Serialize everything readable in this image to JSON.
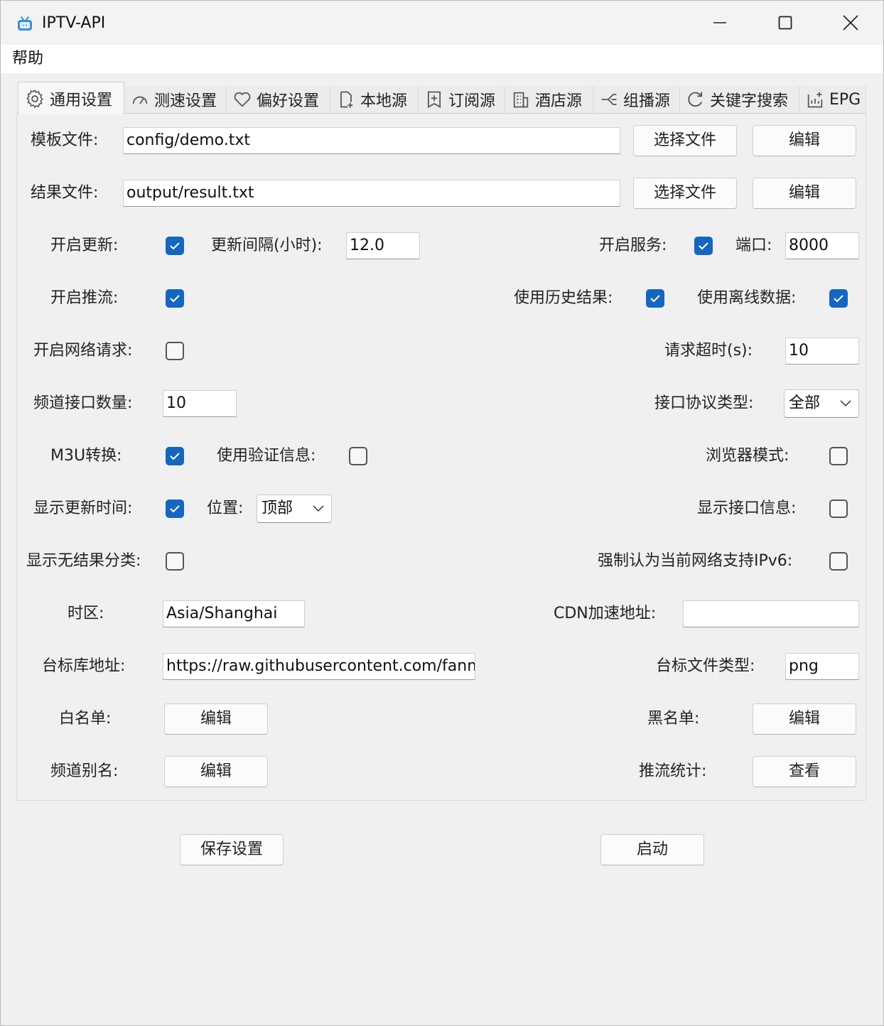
{
  "window": {
    "title": "IPTV-API",
    "icon": "tv-icon"
  },
  "menu": {
    "help": "帮助"
  },
  "tabs": [
    {
      "label": "通用设置",
      "icon": "gear-icon",
      "active": true
    },
    {
      "label": "测速设置",
      "icon": "speedometer-icon"
    },
    {
      "label": "偏好设置",
      "icon": "heart-icon"
    },
    {
      "label": "本地源",
      "icon": "file-add-icon"
    },
    {
      "label": "订阅源",
      "icon": "bookmark-add-icon"
    },
    {
      "label": "酒店源",
      "icon": "building-icon"
    },
    {
      "label": "组播源",
      "icon": "multicast-icon"
    },
    {
      "label": "关键字搜索",
      "icon": "search-refresh-icon"
    },
    {
      "label": "EPG",
      "icon": "epg-icon"
    }
  ],
  "general": {
    "template_file": {
      "label": "模板文件:",
      "value": "config/demo.txt",
      "choose": "选择文件",
      "edit": "编辑"
    },
    "result_file": {
      "label": "结果文件:",
      "value": "output/result.txt",
      "choose": "选择文件",
      "edit": "编辑"
    },
    "open_update": {
      "label": "开启更新:",
      "checked": true
    },
    "update_interval": {
      "label": "更新间隔(小时):",
      "value": "12.0"
    },
    "open_service": {
      "label": "开启服务:",
      "checked": true
    },
    "port": {
      "label": "端口:",
      "value": "8000"
    },
    "open_rtmp": {
      "label": "开启推流:",
      "checked": true
    },
    "use_history": {
      "label": "使用历史结果:",
      "checked": true
    },
    "use_offline": {
      "label": "使用离线数据:",
      "checked": true
    },
    "open_request": {
      "label": "开启网络请求:",
      "checked": false
    },
    "request_timeout": {
      "label": "请求超时(s):",
      "value": "10"
    },
    "urls_limit": {
      "label": "频道接口数量:",
      "value": "10"
    },
    "ipv_type": {
      "label": "接口协议类型:",
      "selected": "全部"
    },
    "m3u": {
      "label": "M3U转换:",
      "checked": true
    },
    "auth_info": {
      "label": "使用验证信息:",
      "checked": false
    },
    "browser_mode": {
      "label": "浏览器模式:",
      "checked": false
    },
    "show_update_time": {
      "label": "显示更新时间:",
      "checked": true
    },
    "position": {
      "label": "位置:",
      "selected": "顶部"
    },
    "show_url_info": {
      "label": "显示接口信息:",
      "checked": false
    },
    "show_no_result": {
      "label": "显示无结果分类:",
      "checked": false
    },
    "force_ipv6": {
      "label": "强制认为当前网络支持IPv6:",
      "checked": false
    },
    "timezone": {
      "label": "时区:",
      "value": "Asia/Shanghai"
    },
    "cdn_url": {
      "label": "CDN加速地址:",
      "value": ""
    },
    "logo_url": {
      "label": "台标库地址:",
      "value": "https://raw.githubusercontent.com/fanmingming/live/main/tv"
    },
    "logo_type": {
      "label": "台标文件类型:",
      "value": "png"
    },
    "whitelist": {
      "label": "白名单:",
      "button": "编辑"
    },
    "blacklist": {
      "label": "黑名单:",
      "button": "编辑"
    },
    "alias": {
      "label": "频道别名:",
      "button": "编辑"
    },
    "rtmp_stat": {
      "label": "推流统计:",
      "button": "查看"
    }
  },
  "footer": {
    "save": "保存设置",
    "start": "启动"
  },
  "colors": {
    "accent": "#1566c0",
    "background": "#f0f0f0"
  }
}
